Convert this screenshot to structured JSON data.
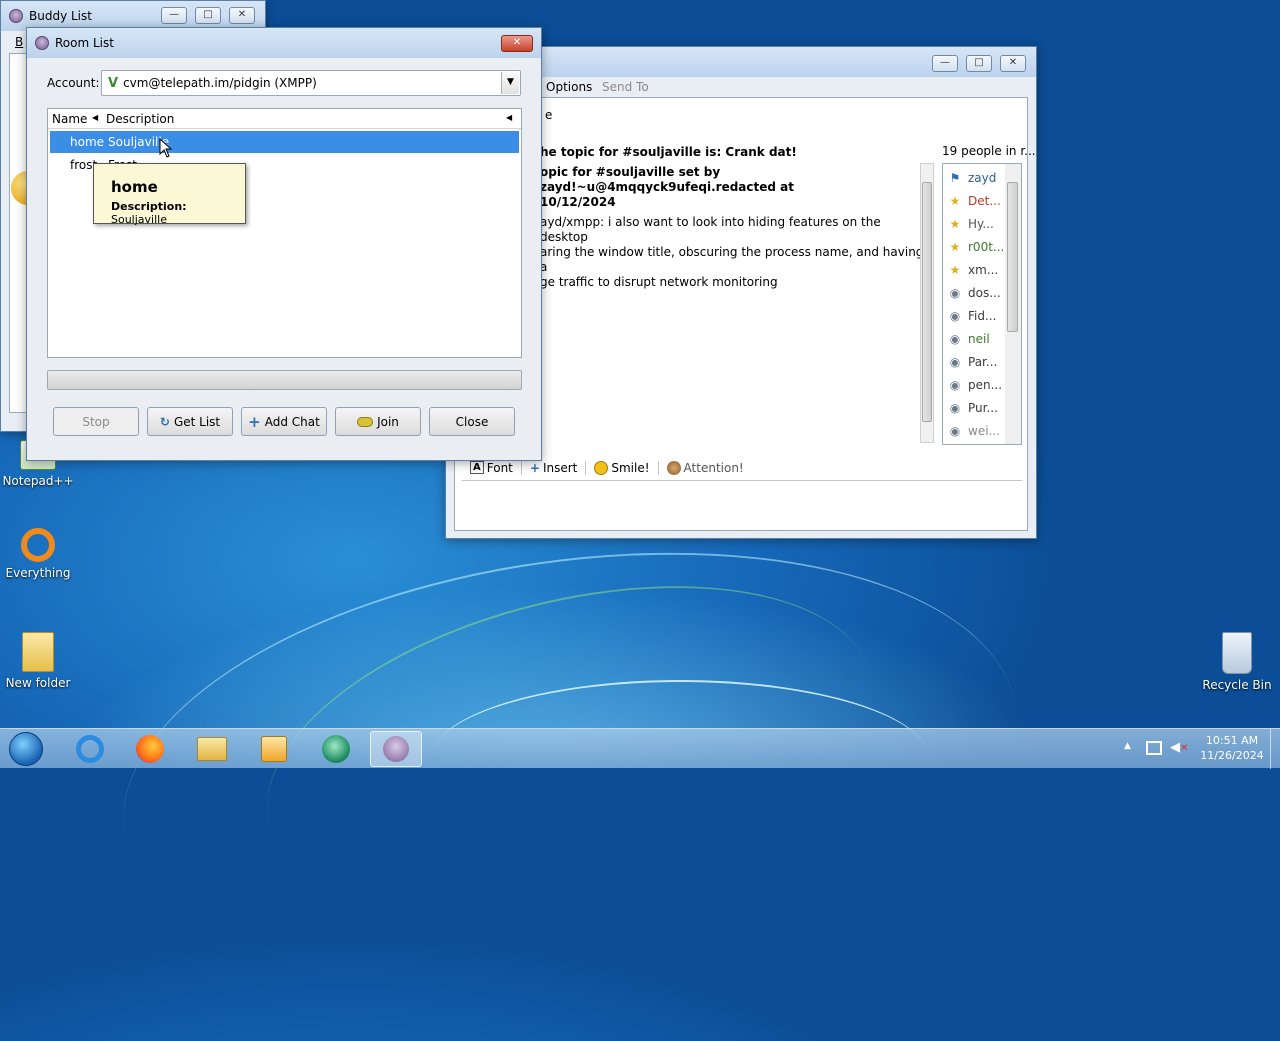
{
  "desktop": {
    "icons": [
      {
        "label": "Notepad++"
      },
      {
        "label": "Everything"
      },
      {
        "label": "New folder"
      },
      {
        "label": "Recycle Bin"
      }
    ]
  },
  "buddy_list": {
    "title": "Buddy List",
    "menu_fragment": "B"
  },
  "chat_window": {
    "menu": [
      "Options",
      "Send To"
    ],
    "topic_fragment": "e",
    "messages": [
      "he topic for #souljaville is: Crank dat!",
      "opic for #souljaville set by zayd!~u@4mqqyck9ufeqi.redacted at",
      " 10/12/2024",
      "ayd/xmpp: i also want to look into hiding features on the desktop",
      "aring the window title, obscuring the process name, and having a",
      "ge traffic to disrupt network monitoring"
    ],
    "people_header": "19 people in r...",
    "people": [
      {
        "name": "zayd",
        "color": "#2e5d8f"
      },
      {
        "name": "Det...",
        "color": "#c0392b"
      },
      {
        "name": "Hy...",
        "color": "#555555"
      },
      {
        "name": "r00t...",
        "color": "#3b7a2a"
      },
      {
        "name": "xm...",
        "color": "#3b3b3b"
      },
      {
        "name": "dos...",
        "color": "#3b3b3b"
      },
      {
        "name": "Fid...",
        "color": "#3b3b3b"
      },
      {
        "name": "neil",
        "color": "#3b7a2a"
      },
      {
        "name": "Par...",
        "color": "#3b3b3b"
      },
      {
        "name": "pen...",
        "color": "#3b3b3b"
      },
      {
        "name": "Pur...",
        "color": "#3b3b3b"
      },
      {
        "name": "wei...",
        "color": "#8a8a8a"
      }
    ],
    "toolbar": [
      "Font",
      "Insert",
      "Smile!",
      "Attention!"
    ]
  },
  "room_list": {
    "title": "Room List",
    "account_label": "Account:",
    "account_value": "cvm@telepath.im/pidgin (XMPP)",
    "columns": [
      "Name",
      "Description"
    ],
    "rows": [
      {
        "name": "home",
        "description": "Souljaville"
      },
      {
        "name": "frost",
        "description": "Frost"
      }
    ],
    "tooltip": {
      "title": "home",
      "desc_label": "Description:",
      "desc_value": "Souljaville"
    },
    "buttons": {
      "stop": "Stop",
      "get_list": "Get List",
      "add_chat": "Add Chat",
      "join": "Join",
      "close": "Close"
    }
  },
  "tray": {
    "time": "10:51 AM",
    "date": "11/26/2024"
  }
}
